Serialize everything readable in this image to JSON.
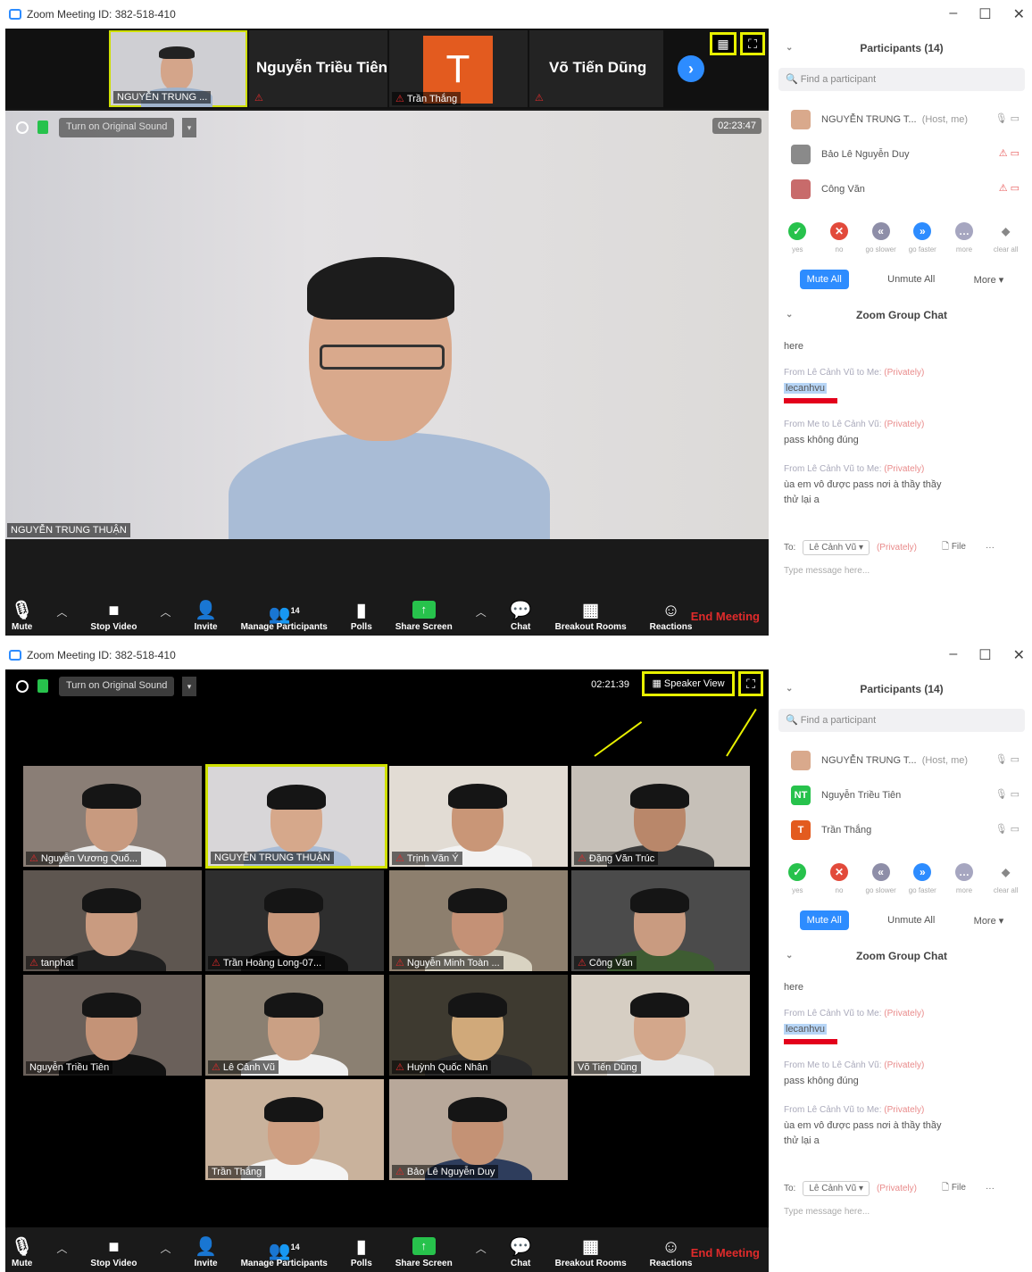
{
  "window_title": "Zoom Meeting ID: 382-518-410",
  "window_controls": {
    "minimize": "–",
    "maximize": "☐",
    "close": "✕"
  },
  "top_strip": {
    "tiles": [
      {
        "name": "NGUYỄN TRUNG ..."
      },
      {
        "name": "Nguyễn Triều Tiên"
      },
      {
        "name": "Trần Thắng",
        "initial": "T"
      },
      {
        "name": "Võ Tiến Dũng"
      }
    ]
  },
  "speaker_view": {
    "original_sound": "Turn on Original Sound",
    "timer": "02:23:47",
    "speaker_name": "NGUYỄN TRUNG THUẬN"
  },
  "gallery_view": {
    "original_sound": "Turn on Original Sound",
    "timer": "02:21:39",
    "speaker_view_btn": "Speaker View",
    "tiles": [
      {
        "name": "Nguyễn Vương Quố..."
      },
      {
        "name": "NGUYỄN TRUNG THUẬN"
      },
      {
        "name": "Trịnh Văn Ý"
      },
      {
        "name": "Đặng Văn Trúc"
      },
      {
        "name": "tanphat"
      },
      {
        "name": "Trần Hoàng Long-07..."
      },
      {
        "name": "Nguyễn Minh Toàn ..."
      },
      {
        "name": "Công Văn"
      },
      {
        "name": "Nguyễn Triều Tiên"
      },
      {
        "name": "Lê Cảnh Vũ"
      },
      {
        "name": "Huỳnh Quốc Nhân"
      },
      {
        "name": "Võ Tiến Dũng"
      },
      {
        "name": "Trần Thắng"
      },
      {
        "name": "Bảo Lê Nguyễn Duy"
      }
    ]
  },
  "toolbar": {
    "mute": "Mute",
    "stop_video": "Stop Video",
    "invite": "Invite",
    "manage_participants": "Manage Participants",
    "participant_count": "14",
    "polls": "Polls",
    "share_screen": "Share Screen",
    "chat": "Chat",
    "breakout_rooms": "Breakout Rooms",
    "reactions": "Reactions",
    "end_meeting": "End Meeting"
  },
  "participants_panel": {
    "title": "Participants (14)",
    "search_placeholder": "Find a participant",
    "list_top": [
      {
        "name": "NGUYỄN TRUNG T...",
        "role": "(Host, me)"
      },
      {
        "name": "Bảo Lê Nguyễn Duy"
      },
      {
        "name": "Công Văn"
      }
    ],
    "list_bottom": [
      {
        "name": "NGUYỄN TRUNG T...",
        "role": "(Host, me)"
      },
      {
        "name": "Nguyễn Triều Tiên",
        "initials": "NT"
      },
      {
        "name": "Trần Thắng",
        "initials": "T"
      }
    ],
    "reactions": [
      "yes",
      "no",
      "go slower",
      "go faster",
      "more",
      "clear all"
    ],
    "mute_all": "Mute All",
    "unmute_all": "Unmute All",
    "more": "More ▾"
  },
  "chat_panel": {
    "title": "Zoom Group Chat",
    "msg0": "here",
    "m1_meta_from": "From Lê Cảnh Vũ to Me:",
    "m1_meta_priv": "(Privately)",
    "m1_text": "lecanhvu",
    "m2_meta_from": "From Me to Lê Cảnh Vũ:",
    "m2_meta_priv": "(Privately)",
    "m2_text": "pass không đúng",
    "m3_meta_from": "From Lê Cảnh Vũ to Me:",
    "m3_meta_priv": "(Privately)",
    "m3_text": "ùa em vô được pass nơi à thầy thầy thử lại a",
    "to_label": "To:",
    "to_target": "Lê Cảnh Vũ ▾",
    "to_priv": "(Privately)",
    "file": "File",
    "input_placeholder": "Type message here..."
  }
}
